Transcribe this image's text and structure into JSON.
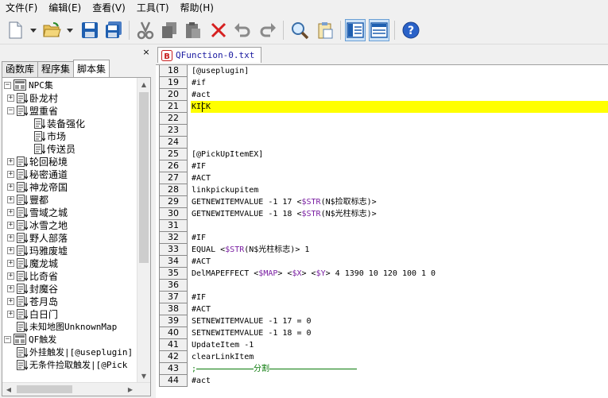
{
  "menu": [
    {
      "label": "文件(F)"
    },
    {
      "label": "编辑(E)"
    },
    {
      "label": "查看(V)"
    },
    {
      "label": "工具(T)"
    },
    {
      "label": "帮助(H)"
    }
  ],
  "toolbar": {
    "icons": [
      "new-file-icon",
      "open-folder-icon",
      "save-icon",
      "save-all-icon",
      "cut-icon",
      "copy-icon",
      "paste-icon",
      "delete-icon",
      "undo-icon",
      "redo-icon",
      "find-icon",
      "clipboard-icon",
      "layout-left-icon",
      "layout-list-icon",
      "help-icon"
    ]
  },
  "left_panel": {
    "close_glyph": "×",
    "tabs": [
      {
        "label": "函数库"
      },
      {
        "label": "程序集"
      },
      {
        "label": "脚本集",
        "active": true
      }
    ],
    "tree": [
      {
        "label": "NPC集",
        "level": 0,
        "expander": "−",
        "root": true,
        "mono": false
      },
      {
        "label": "卧龙村",
        "level": 1,
        "expander": "+"
      },
      {
        "label": "盟重省",
        "level": 1,
        "expander": "−"
      },
      {
        "label": "装备强化",
        "level": 2,
        "expander": ""
      },
      {
        "label": "市场",
        "level": 2,
        "expander": ""
      },
      {
        "label": "传送员",
        "level": 2,
        "expander": ""
      },
      {
        "label": "轮回秘境",
        "level": 1,
        "expander": "+"
      },
      {
        "label": "秘密通道",
        "level": 1,
        "expander": "+"
      },
      {
        "label": "神龙帝国",
        "level": 1,
        "expander": "+"
      },
      {
        "label": "豐都",
        "level": 1,
        "expander": "+"
      },
      {
        "label": "雪域之城",
        "level": 1,
        "expander": "+"
      },
      {
        "label": "冰雪之地",
        "level": 1,
        "expander": "+"
      },
      {
        "label": "野人部落",
        "level": 1,
        "expander": "+"
      },
      {
        "label": "玛雅废墟",
        "level": 1,
        "expander": "+"
      },
      {
        "label": "魔龙城",
        "level": 1,
        "expander": "+"
      },
      {
        "label": "比奇省",
        "level": 1,
        "expander": "+"
      },
      {
        "label": "封魔谷",
        "level": 1,
        "expander": "+"
      },
      {
        "label": "苍月岛",
        "level": 1,
        "expander": "+"
      },
      {
        "label": "白日门",
        "level": 1,
        "expander": "+"
      },
      {
        "label": "未知地图UnknownMap",
        "level": 1,
        "expander": ""
      },
      {
        "label": "QF触发",
        "level": 0,
        "expander": "−",
        "root": true
      },
      {
        "label": "外挂触发|[@useplugin]",
        "level": 1,
        "expander": ""
      },
      {
        "label": "无条件捡取触发|[@Pick",
        "level": 1,
        "expander": ""
      }
    ]
  },
  "editor": {
    "tab_label": "QFunction-0.txt",
    "lines": [
      {
        "n": "18",
        "segs": [
          {
            "t": "[@useplugin]"
          }
        ]
      },
      {
        "n": "19",
        "segs": [
          {
            "t": "#if"
          }
        ]
      },
      {
        "n": "20",
        "segs": [
          {
            "t": "#act"
          }
        ]
      },
      {
        "n": "21",
        "hl": true,
        "segs": [
          {
            "t": "KICK"
          }
        ]
      },
      {
        "n": "22",
        "segs": []
      },
      {
        "n": "23",
        "segs": []
      },
      {
        "n": "24",
        "segs": []
      },
      {
        "n": "25",
        "segs": [
          {
            "t": "[@PickUpItemEX]"
          }
        ]
      },
      {
        "n": "26",
        "segs": [
          {
            "t": "#IF"
          }
        ]
      },
      {
        "n": "27",
        "segs": [
          {
            "t": "#ACT"
          }
        ]
      },
      {
        "n": "28",
        "segs": [
          {
            "t": "linkpickupitem"
          }
        ]
      },
      {
        "n": "29",
        "segs": [
          {
            "t": "GETNEWITEMVALUE -1 17 <"
          },
          {
            "t": "$STR",
            "c": "kw"
          },
          {
            "t": "(N$捡取标志)>"
          }
        ]
      },
      {
        "n": "30",
        "segs": [
          {
            "t": "GETNEWITEMVALUE -1 18 <"
          },
          {
            "t": "$STR",
            "c": "kw"
          },
          {
            "t": "(N$光柱标志)>"
          }
        ]
      },
      {
        "n": "31",
        "segs": []
      },
      {
        "n": "32",
        "segs": [
          {
            "t": "#IF"
          }
        ]
      },
      {
        "n": "33",
        "segs": [
          {
            "t": "EQUAL <"
          },
          {
            "t": "$STR",
            "c": "kw"
          },
          {
            "t": "(N$光柱标志)> 1"
          }
        ]
      },
      {
        "n": "34",
        "segs": [
          {
            "t": "#ACT"
          }
        ]
      },
      {
        "n": "35",
        "segs": [
          {
            "t": "DelMAPEFFECT <"
          },
          {
            "t": "$MAP",
            "c": "kw"
          },
          {
            "t": "> <"
          },
          {
            "t": "$X",
            "c": "kw"
          },
          {
            "t": "> <"
          },
          {
            "t": "$Y",
            "c": "kw"
          },
          {
            "t": "> 4 1390 10 120 100 1 0"
          }
        ]
      },
      {
        "n": "36",
        "segs": []
      },
      {
        "n": "37",
        "segs": [
          {
            "t": "#IF"
          }
        ]
      },
      {
        "n": "38",
        "segs": [
          {
            "t": "#ACT"
          }
        ]
      },
      {
        "n": "39",
        "segs": [
          {
            "t": "SETNEWITEMVALUE -1 17 = 0"
          }
        ]
      },
      {
        "n": "40",
        "segs": [
          {
            "t": "SETNEWITEMVALUE -1 18 = 0"
          }
        ]
      },
      {
        "n": "41",
        "segs": [
          {
            "t": "UpdateItem -1"
          }
        ]
      },
      {
        "n": "42",
        "segs": [
          {
            "t": "clearLinkItem"
          }
        ]
      },
      {
        "n": "43",
        "divider": true,
        "segs": [
          {
            "t": ";",
            "c": "green-txt"
          },
          {
            "t": "分割",
            "c": "green-txt",
            "divider_label": true
          }
        ]
      },
      {
        "n": "44",
        "segs": [
          {
            "t": "#act"
          }
        ]
      }
    ]
  }
}
